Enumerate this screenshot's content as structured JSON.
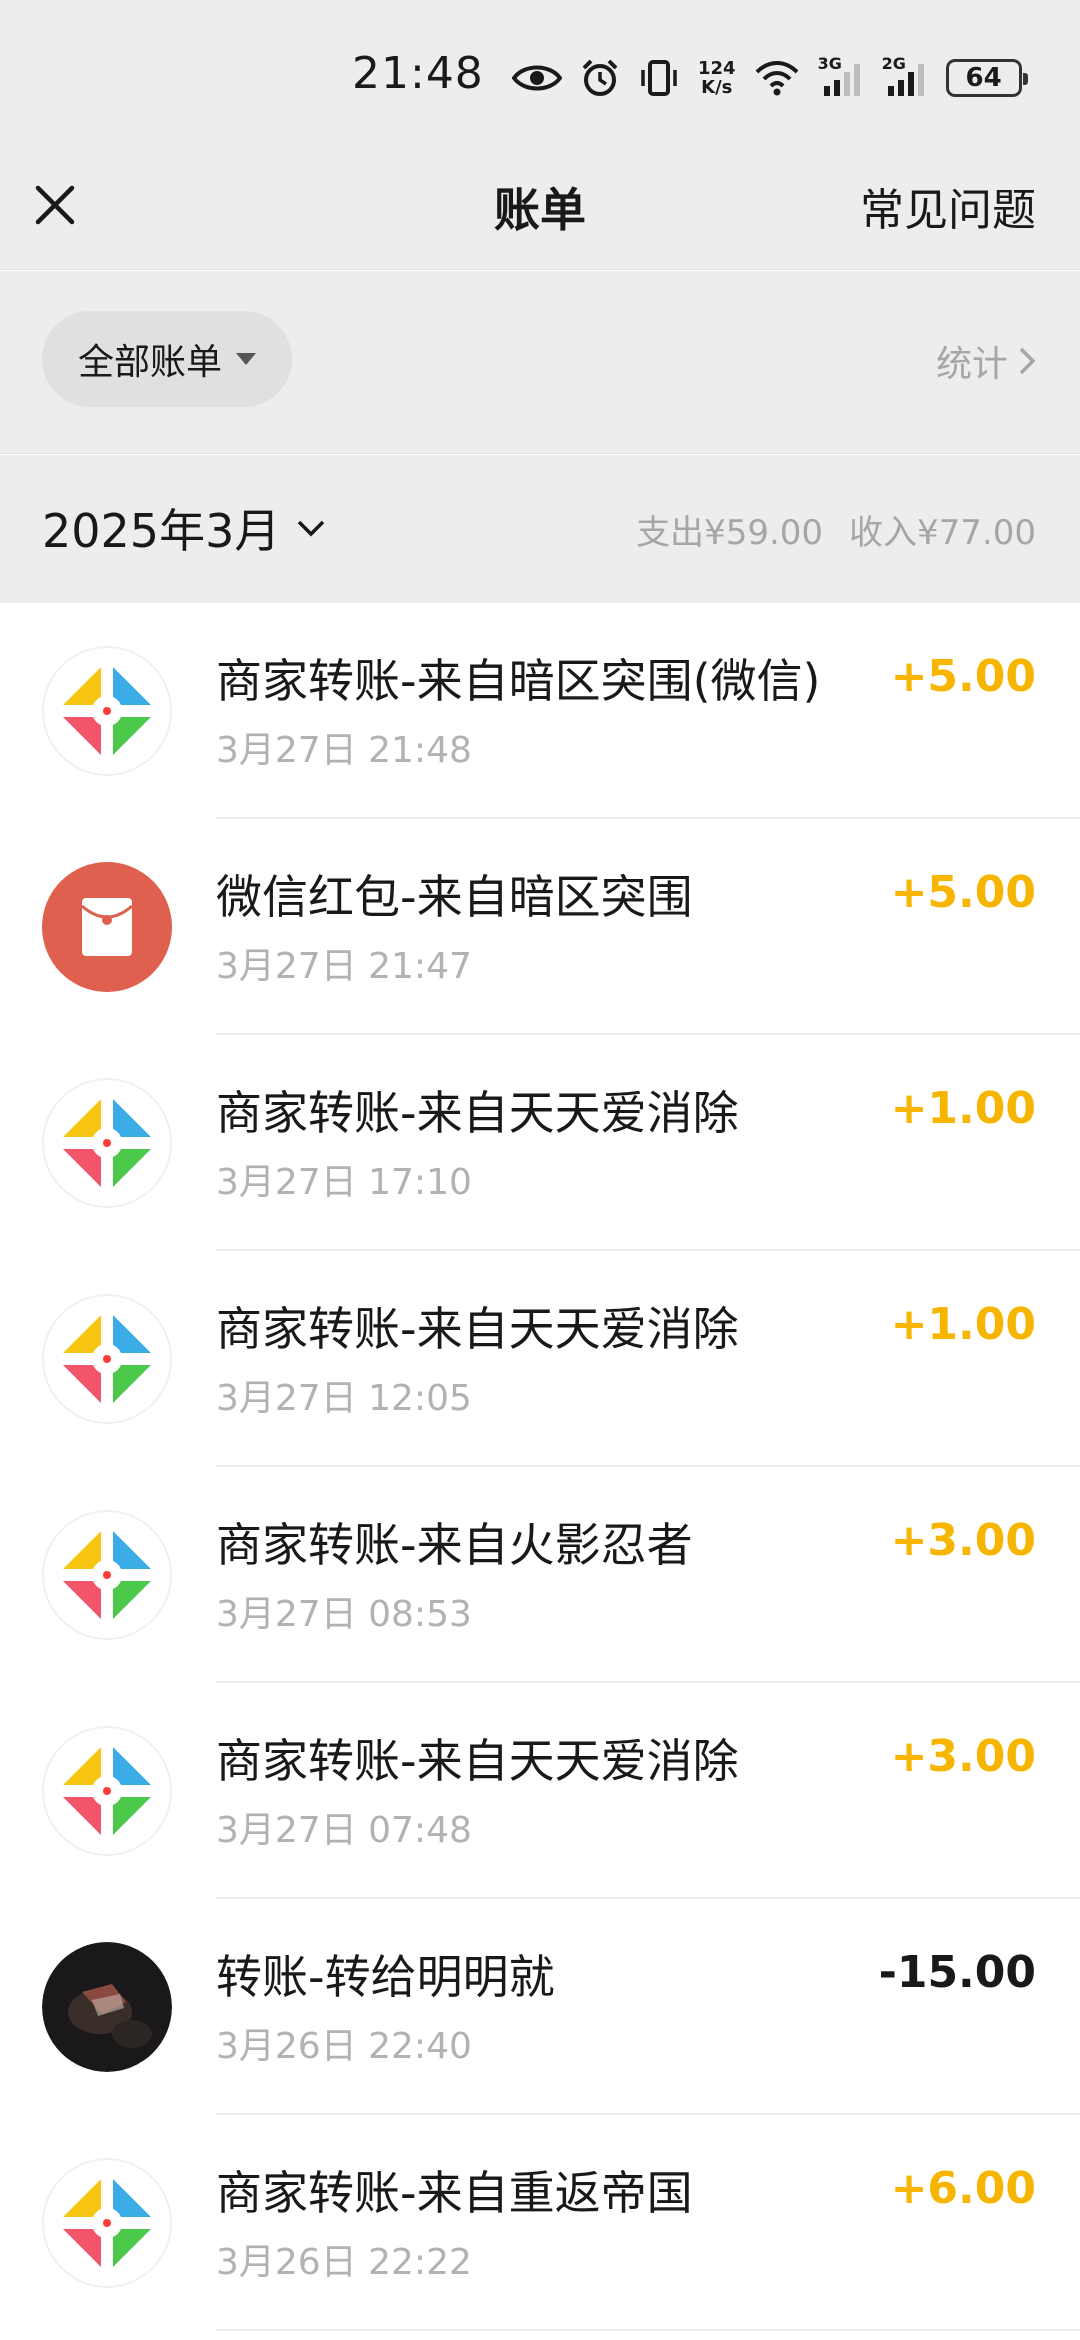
{
  "status_bar": {
    "time": "21:48",
    "net_speed_value": "124",
    "net_speed_unit": "K/s",
    "sim1_label": "3G",
    "sim2_label": "2G",
    "battery": "64"
  },
  "nav": {
    "title": "账单",
    "faq_label": "常见问题"
  },
  "filter": {
    "chip_label": "全部账单",
    "stats_label": "统计"
  },
  "month": {
    "label": "2025年3月",
    "expense_label": "支出",
    "expense_value": "¥59.00",
    "income_label": "收入",
    "income_value": "¥77.00"
  },
  "colors": {
    "income_amount": "#f7b500",
    "expense_amount": "#191919",
    "red_packet": "#e0604f"
  },
  "transactions": [
    {
      "title": "商家转账-来自暗区突围(微信)",
      "time": "3月27日 21:48",
      "amount": "+5.00",
      "icon": "merchant-icon"
    },
    {
      "title": "微信红包-来自暗区突围",
      "time": "3月27日 21:47",
      "amount": "+5.00",
      "icon": "red-packet-icon"
    },
    {
      "title": "商家转账-来自天天爱消除",
      "time": "3月27日 17:10",
      "amount": "+1.00",
      "icon": "merchant-icon"
    },
    {
      "title": "商家转账-来自天天爱消除",
      "time": "3月27日 12:05",
      "amount": "+1.00",
      "icon": "merchant-icon"
    },
    {
      "title": "商家转账-来自火影忍者",
      "time": "3月27日 08:53",
      "amount": "+3.00",
      "icon": "merchant-icon"
    },
    {
      "title": "商家转账-来自天天爱消除",
      "time": "3月27日 07:48",
      "amount": "+3.00",
      "icon": "merchant-icon"
    },
    {
      "title": "转账-转给明明就",
      "time": "3月26日 22:40",
      "amount": "-15.00",
      "icon": "user-avatar"
    },
    {
      "title": "商家转账-来自重返帝国",
      "time": "3月26日 22:22",
      "amount": "+6.00",
      "icon": "merchant-icon"
    }
  ]
}
